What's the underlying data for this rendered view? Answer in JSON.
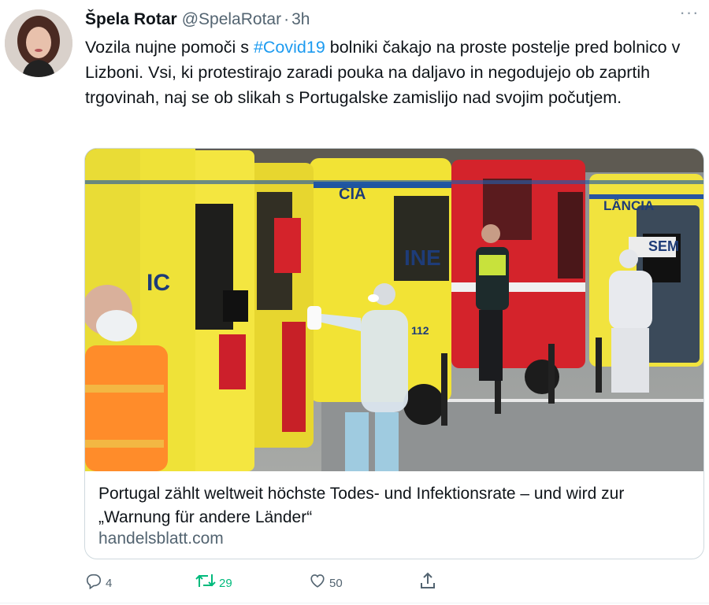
{
  "tweet": {
    "author_name": "Špela Rotar",
    "author_handle": "@SpelaRotar",
    "separator": "·",
    "time": "3h",
    "text_before": "Vozila nujne pomoči s ",
    "hashtag": "#Covid19",
    "text_after": " bolniki čakajo na proste postelje pred bolnico v Lizboni. Vsi, ki protestirajo zaradi pouka na daljavo in negodujejo ob zaprtih trgovinah, naj se ob slikah s Portugalske zamislijo nad svojim počutjem.",
    "more_label": "···"
  },
  "card": {
    "title": "Portugal zählt weltweit höchste Todes- und Infektionsrate – und wird zur „Warnung für andere Länder“",
    "domain": "handelsblatt.com",
    "image_text": {
      "cia": "CIA",
      "ine": "INE",
      "lancia": "LÂNCIA",
      "sem": "SEM",
      "ic": "IC",
      "n112": "112"
    }
  },
  "actions": {
    "reply_count": "4",
    "retweet_count": "29",
    "like_count": "50"
  },
  "colors": {
    "accent": "#1d9bf0",
    "retweet": "#00ba7c",
    "secondary_text": "#536471"
  },
  "icons": {
    "reply": "speech-bubble-icon",
    "retweet": "retweet-arrows-icon",
    "like": "heart-icon",
    "share": "share-upload-icon",
    "more": "ellipsis-icon"
  }
}
